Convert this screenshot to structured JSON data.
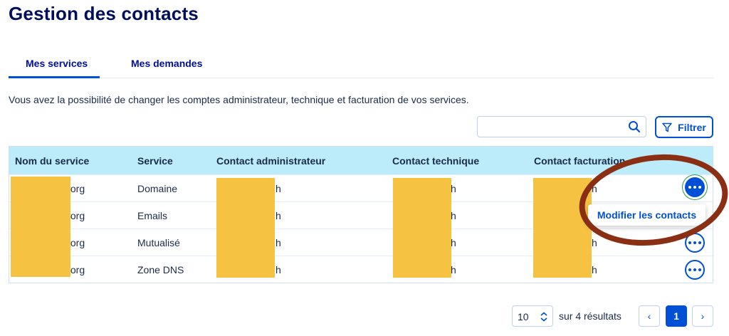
{
  "page": {
    "title": "Gestion des contacts",
    "description": "Vous avez la possibilité de changer les comptes administrateur, technique et facturation de vos services."
  },
  "tabs": [
    {
      "label": "Mes services",
      "active": true
    },
    {
      "label": "Mes demandes",
      "active": false
    }
  ],
  "search": {
    "value": "",
    "placeholder": ""
  },
  "filter": {
    "label": "Filtrer"
  },
  "table": {
    "headers": [
      "Nom du service",
      "Service",
      "Contact administrateur",
      "Contact technique",
      "Contact facturation"
    ],
    "rows": [
      {
        "name": ".org",
        "service": "Domaine",
        "admin": "h",
        "tech": "h",
        "billing": "h"
      },
      {
        "name": ".org",
        "service": "Emails",
        "admin": "h",
        "tech": "h",
        "billing": ""
      },
      {
        "name": ".org",
        "service": "Mutualisé",
        "admin": "h",
        "tech": "h",
        "billing": "h"
      },
      {
        "name": ".org",
        "service": "Zone DNS",
        "admin": "h",
        "tech": "h",
        "billing": "h"
      }
    ]
  },
  "action_menu": {
    "label": "Modifier les contacts"
  },
  "pagination": {
    "per_page": "10",
    "results": "sur 4 résultats",
    "current_page": "1",
    "prev_label": "‹",
    "next_label": "›"
  },
  "colors": {
    "title": "#000e5c",
    "accent": "#0050d7",
    "header_bg": "#bcebfa",
    "redaction": "#f5c242",
    "highlight_ring": "#8a2f14"
  },
  "icons": [
    "search-icon",
    "filter-icon",
    "more-options-icon",
    "chevron-updown-icon",
    "chevron-left-icon",
    "chevron-right-icon"
  ]
}
